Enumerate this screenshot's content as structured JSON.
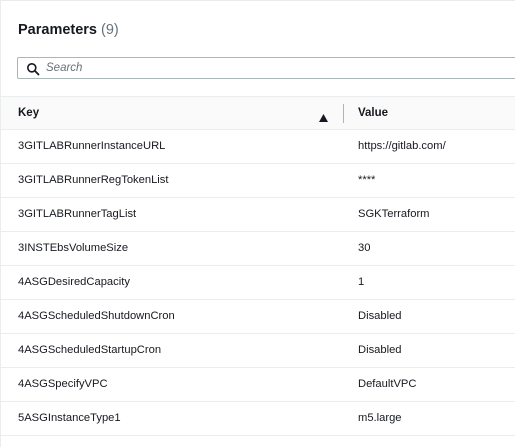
{
  "header": {
    "title": "Parameters",
    "count": "(9)"
  },
  "search": {
    "placeholder": "Search",
    "icon": "search-icon"
  },
  "table": {
    "columns": {
      "key": "Key",
      "value": "Value"
    },
    "sort": {
      "column": "Key",
      "direction": "ascending",
      "icon": "sort-up-icon"
    },
    "rows": [
      {
        "key": "3GITLABRunnerInstanceURL",
        "value": "https://gitlab.com/"
      },
      {
        "key": "3GITLABRunnerRegTokenList",
        "value": "****"
      },
      {
        "key": "3GITLABRunnerTagList",
        "value": "SGKTerraform"
      },
      {
        "key": "3INSTEbsVolumeSize",
        "value": "30"
      },
      {
        "key": "4ASGDesiredCapacity",
        "value": "1"
      },
      {
        "key": "4ASGScheduledShutdownCron",
        "value": "Disabled"
      },
      {
        "key": "4ASGScheduledStartupCron",
        "value": "Disabled"
      },
      {
        "key": "4ASGSpecifyVPC",
        "value": "DefaultVPC"
      },
      {
        "key": "5ASGInstanceType1",
        "value": "m5.large"
      }
    ]
  },
  "colors": {
    "text": "#16191f",
    "muted": "#687078",
    "border": "#eaeded",
    "header_bg": "#fafafa"
  }
}
